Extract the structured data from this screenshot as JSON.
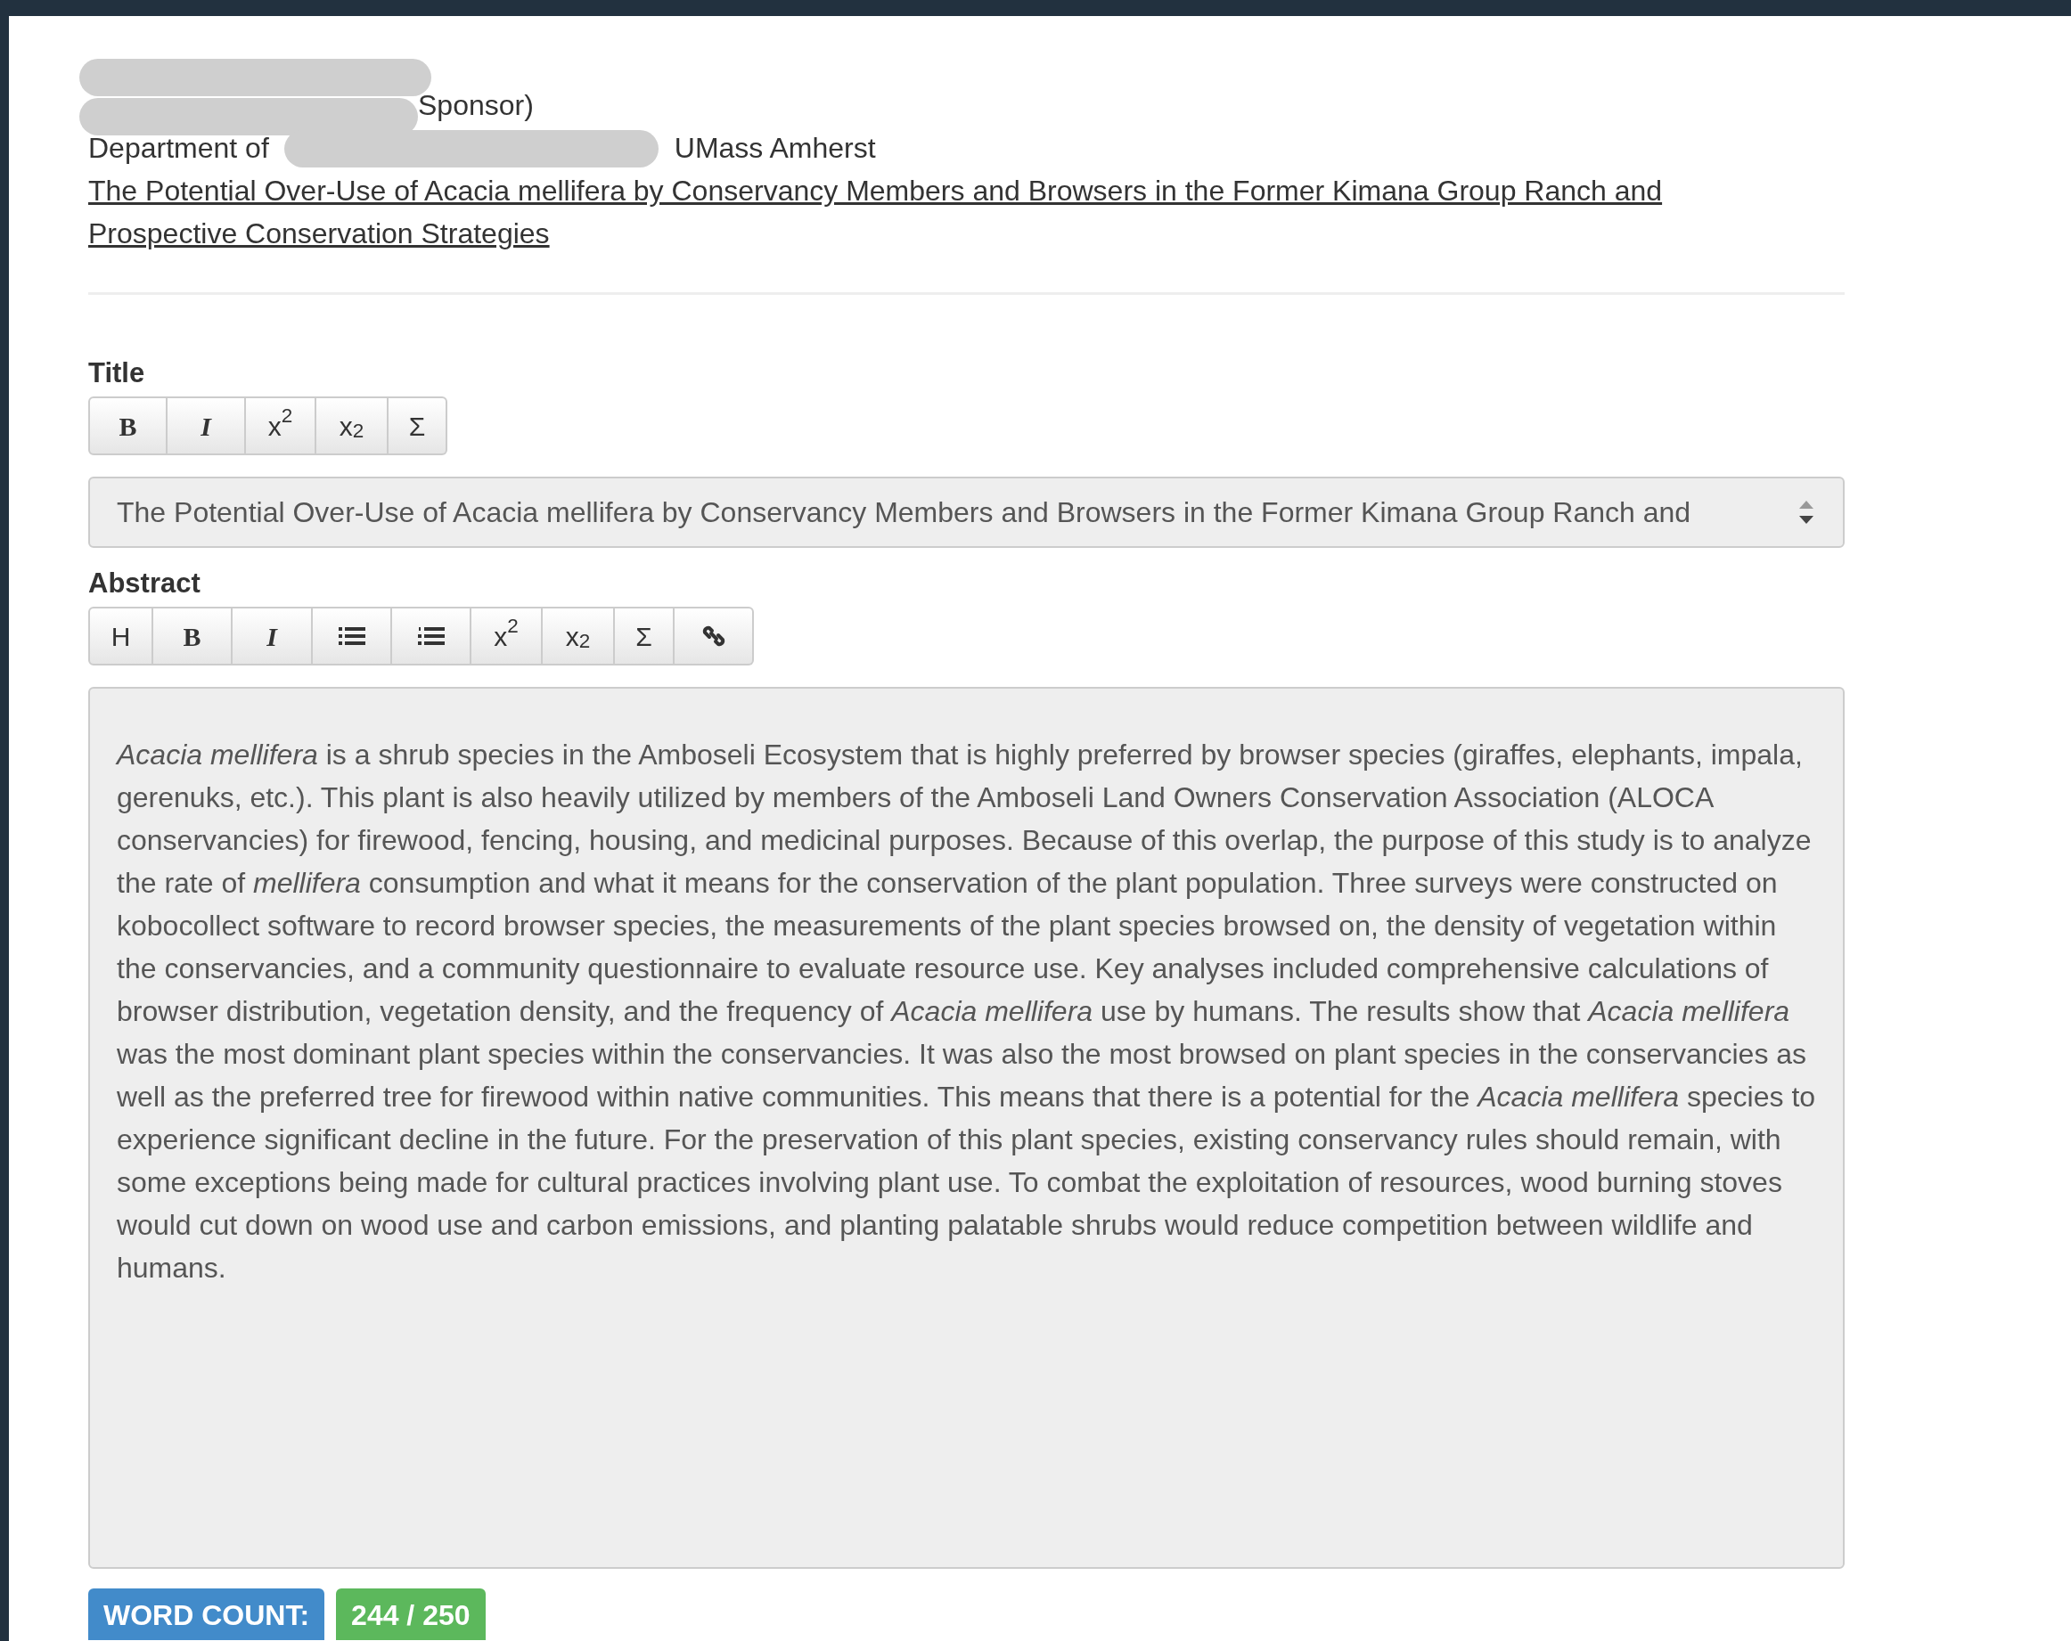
{
  "header": {
    "sponsor_fragment": "Sponsor)",
    "department_prefix": "Department of",
    "department_suffix": "UMass Amherst",
    "title_link": "The Potential Over-Use of Acacia mellifera by Conservancy Members and Browsers in the Former Kimana Group Ranch and Prospective Conservation Strategies"
  },
  "title_section": {
    "label": "Title",
    "toolbar": [
      {
        "kind": "bold",
        "label": "B"
      },
      {
        "kind": "italic",
        "label": "I"
      },
      {
        "kind": "text",
        "label": "x$^{2}$"
      },
      {
        "kind": "text",
        "label": "x$_{2}$"
      },
      {
        "kind": "text",
        "label": "Σ"
      }
    ],
    "value": "The Potential Over-Use of Acacia mellifera by Conservancy Members and Browsers in the Former Kimana Group Ranch and"
  },
  "abstract_section": {
    "label": "Abstract",
    "toolbar": [
      {
        "kind": "text",
        "label": "H"
      },
      {
        "kind": "bold",
        "label": "B"
      },
      {
        "kind": "italic",
        "label": "I"
      },
      {
        "kind": "bullets"
      },
      {
        "kind": "numbers"
      },
      {
        "kind": "text",
        "label": "x$^{2}$"
      },
      {
        "kind": "text",
        "label": "x$_{2}$"
      },
      {
        "kind": "text",
        "label": "Σ"
      },
      {
        "kind": "link"
      }
    ],
    "text": "*Acacia mellifera* is a shrub species in the Amboseli Ecosystem that is highly preferred by browser species (giraffes, elephants, impala, gerenuks, etc.). This plant is also heavily utilized by members of the Amboseli Land Owners Conservation Association (ALOCA conservancies) for firewood, fencing, housing, and medicinal purposes. Because of this overlap, the purpose of this study is to analyze the rate of *mellifera* consumption and what it means for the conservation of the plant population. Three surveys were constructed on kobocollect software to record browser species, the measurements of the plant species browsed on, the density of vegetation within the conservancies, and a community questionnaire to evaluate resource use. Key analyses included comprehensive calculations of browser distribution, vegetation density, and the frequency of *Acacia mellifera* use by humans. The results show that *Acacia mellifera* was the most dominant plant species within the conservancies. It was also the most browsed on plant species in the conservancies as well as the preferred tree for firewood within native communities. This means that there is a potential for the *Acacia mellifera* species to experience significant decline in the future. For the preservation of this plant species, existing conservancy rules should remain, with some exceptions being made for cultural practices involving plant use. To combat the exploitation of resources, wood burning stoves would cut down on wood use and carbon emissions, and planting palatable shrubs would reduce competition between wildlife and humans."
  },
  "word_count": {
    "label": "WORD COUNT:",
    "value": "244 / 250"
  }
}
